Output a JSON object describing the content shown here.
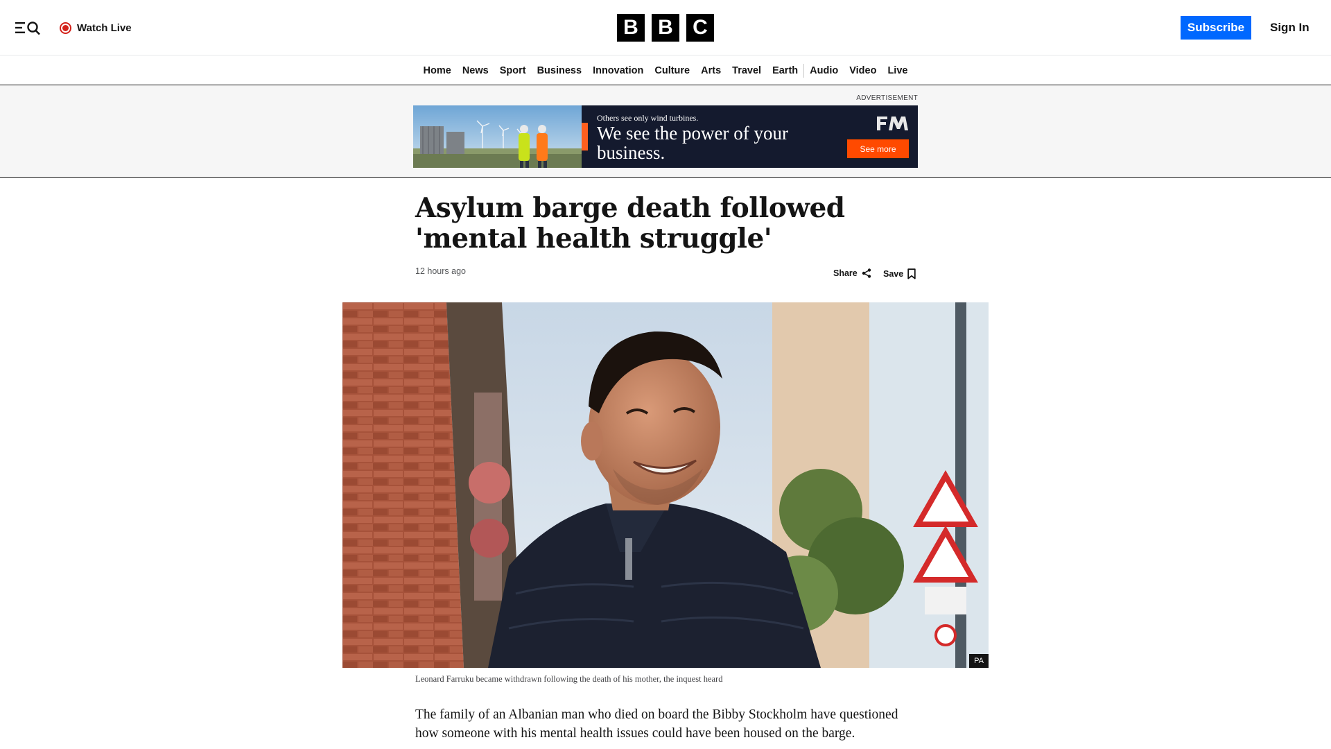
{
  "header": {
    "watch_live_label": "Watch Live",
    "logo_letters": [
      "B",
      "B",
      "C"
    ],
    "subscribe_label": "Subscribe",
    "signin_label": "Sign In"
  },
  "nav": {
    "items": [
      "Home",
      "News",
      "Sport",
      "Business",
      "Innovation",
      "Culture",
      "Arts",
      "Travel",
      "Earth",
      "Audio",
      "Video",
      "Live"
    ]
  },
  "ad": {
    "label": "ADVERTISEMENT",
    "small_text": "Others see only wind turbines.",
    "big_text": "We see the power of your business.",
    "cta_label": "See more",
    "brand_mark": "FM"
  },
  "article": {
    "headline": "Asylum barge death followed 'mental health struggle'",
    "timestamp": "12 hours ago",
    "share_label": "Share",
    "save_label": "Save",
    "image_credit": "PA",
    "caption": "Leonard Farruku became withdrawn following the death of his mother, the inquest heard",
    "body": "The family of an Albanian man who died on board the Bibby Stockholm have questioned how someone with his mental health issues could have been housed on the barge."
  },
  "colors": {
    "subscribe_blue": "#0068ff",
    "live_red": "#d4221a",
    "ad_navy": "#141a2e",
    "ad_orange": "#ff4a00"
  }
}
